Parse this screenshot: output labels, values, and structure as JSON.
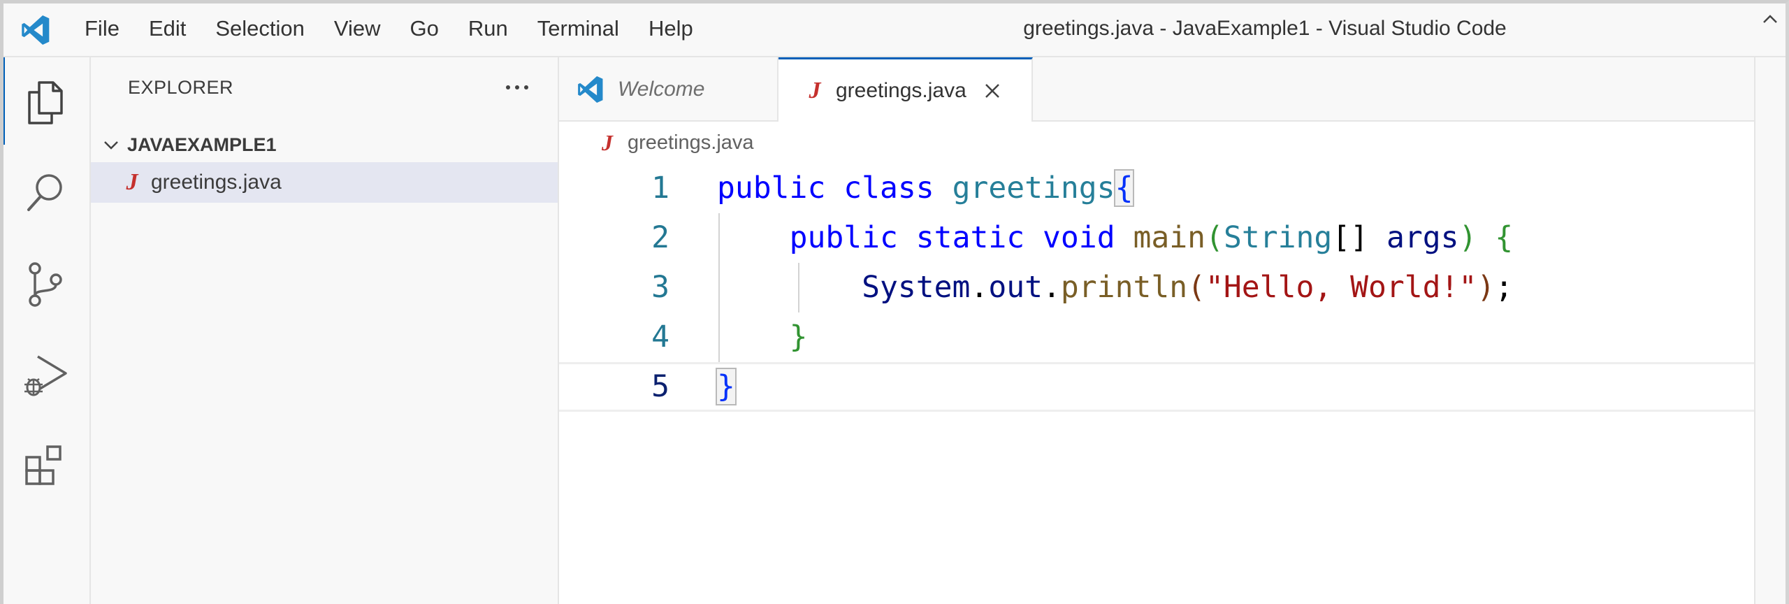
{
  "window": {
    "title": "greetings.java - JavaExample1 - Visual Studio Code"
  },
  "menu": [
    "File",
    "Edit",
    "Selection",
    "View",
    "Go",
    "Run",
    "Terminal",
    "Help"
  ],
  "activity_bar": {
    "items": [
      {
        "name": "explorer",
        "icon": "files-icon",
        "active": true
      },
      {
        "name": "search",
        "icon": "search-icon",
        "active": false
      },
      {
        "name": "source-control",
        "icon": "source-control-icon",
        "active": false
      },
      {
        "name": "run-and-debug",
        "icon": "run-debug-icon",
        "active": false
      },
      {
        "name": "extensions",
        "icon": "extensions-icon",
        "active": false
      }
    ]
  },
  "sidebar": {
    "title": "EXPLORER",
    "folder": "JAVAEXAMPLE1",
    "files": [
      {
        "label": "greetings.java",
        "icon": "java-icon",
        "selected": true
      }
    ]
  },
  "tabs": [
    {
      "label": "Welcome",
      "icon": "vscode-logo-icon",
      "active": false,
      "preview": true
    },
    {
      "label": "greetings.java",
      "icon": "java-icon",
      "active": true
    }
  ],
  "breadcrumb": [
    "greetings.java"
  ],
  "editor": {
    "line_numbers": [
      "1",
      "2",
      "3",
      "4",
      "5"
    ],
    "current_line": 5,
    "lines": [
      "public class greetings{",
      "    public static void main(String[] args) {",
      "        System.out.println(\"Hello, World!\");",
      "    }",
      "}"
    ]
  },
  "colors": {
    "accent": "#005fb8",
    "keyword": "#0000ff",
    "type": "#267f99",
    "function": "#795e26",
    "variable": "#001080",
    "string": "#a31515",
    "java_icon": "#c5302d"
  }
}
